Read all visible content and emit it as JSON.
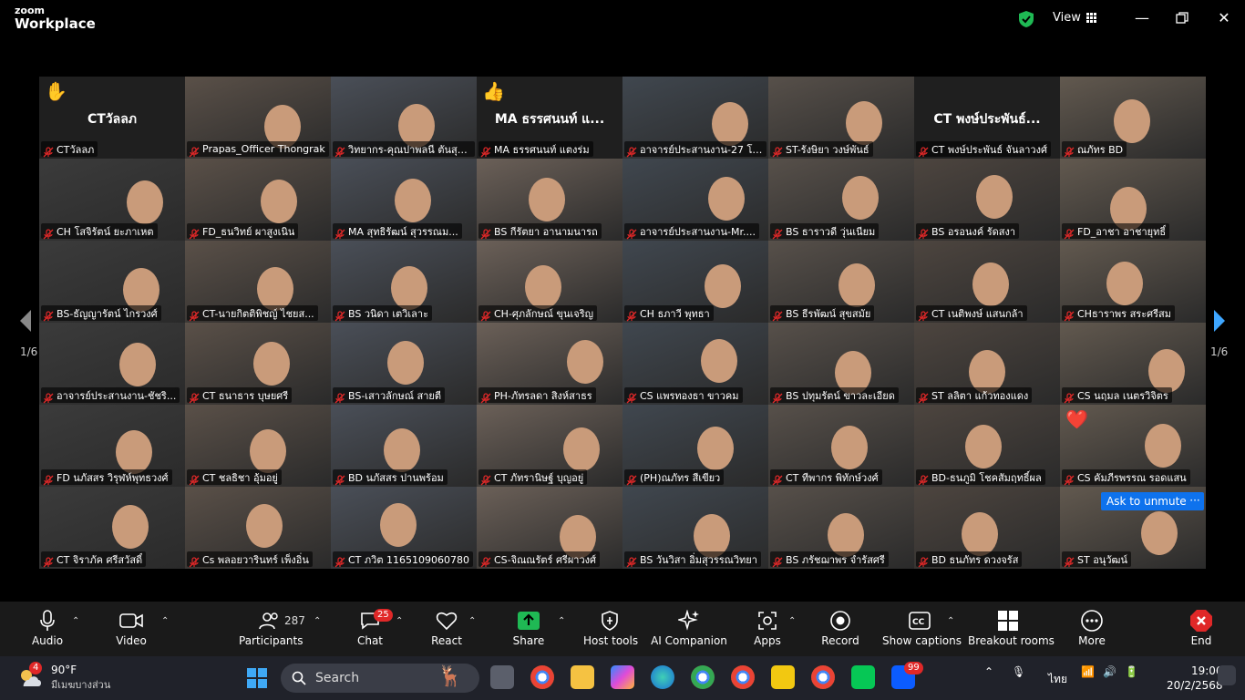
{
  "app": {
    "brand_top": "zoom",
    "brand_bottom": "Workplace"
  },
  "titlebar": {
    "view_label": "View"
  },
  "pagination": {
    "left": "1/6",
    "right": "1/6"
  },
  "unmute": {
    "label": "Ask to unmute",
    "more": "···"
  },
  "tiles": [
    {
      "name": "CTวัลลภ",
      "big": "CTวัลลภ",
      "reaction": "✋"
    },
    {
      "name": "Prapas_Officer Thongrak",
      "active": true
    },
    {
      "name": "วิทยากร-คุณปาพลนี ตันสุวร..."
    },
    {
      "name": "MA ธรรศนนท์ แตงร่ม",
      "big": "MA ธรรศนนท์ แ...",
      "reaction": "👍"
    },
    {
      "name": "อาจารย์ประสานงาน-27 โอม ..."
    },
    {
      "name": "ST-รังษิยา วงษ์พันธ์"
    },
    {
      "name": "CT พงษ์ประพันธ์ จันลาวงศ์",
      "big": "CT พงษ์ประพันธ์..."
    },
    {
      "name": "ณภัทร BD"
    },
    {
      "name": "CH โสจิรัตน์ ยะภาเหต"
    },
    {
      "name": "FD_ธนวิทย์ ผาสูงเนิน"
    },
    {
      "name": "MA สุทธิรัฒน์ สุวรรณม..."
    },
    {
      "name": "BS กีรัตยา อานามนารถ"
    },
    {
      "name": "อาจารย์ประสานงาน-Mr...."
    },
    {
      "name": "BS ธาราวดี วุ่นเนียม"
    },
    {
      "name": "BS อรอนงค์ รัดสงา"
    },
    {
      "name": "FD_อาชา อาชายุทธิ์"
    },
    {
      "name": "BS-ธัญญารัตน์ ไกรวงศ์"
    },
    {
      "name": "CT-นายกิตติพิชญ์ ไชยส..."
    },
    {
      "name": "BS วนิดา เตวิเลาะ"
    },
    {
      "name": "CH-ศุภลักษณ์ ขุนเจริญ"
    },
    {
      "name": "CH ธภาวี พุทธา"
    },
    {
      "name": "BS ธีรพัฒน์ สุขสมัย"
    },
    {
      "name": "CT เนติพงษ์ แสนกล้า"
    },
    {
      "name": "CHธาราพร สระศรีสม"
    },
    {
      "name": "อาจารย์ประสานงาน-ชัชริ..."
    },
    {
      "name": "CT ธนาธาร บุษยศรี"
    },
    {
      "name": "BS-เสาวลักษณ์ สายตี"
    },
    {
      "name": "PH-ภัทรลดา สิงห์สาธร"
    },
    {
      "name": "CS แพรทองธา ขาวคม"
    },
    {
      "name": "BS ปทุมรัตน์ ขาวละเอียด"
    },
    {
      "name": "ST ลลิตา แก้วทองแดง"
    },
    {
      "name": "CS นฤมล เนตรวิจิตร"
    },
    {
      "name": "FD นภัสสร วิรุฬห์พุทธวงศ์"
    },
    {
      "name": "CT ชลธิชา อุ้มอยู่"
    },
    {
      "name": "BD นภัสสร ปานพร้อม"
    },
    {
      "name": "CT ภัทรานิษฐ์ บุญอยู่"
    },
    {
      "name": "(PH)ณภัทร สีเขียว"
    },
    {
      "name": "CT ทีพากร พิทักษ์วงศ์"
    },
    {
      "name": "BD-ธนภูมิ โชคสัมฤทธิ์ผล"
    },
    {
      "name": "CS คัมภีรพรรณ รอดแสน",
      "reaction": "❤️"
    },
    {
      "name": "CT จิราภัค ศรีสวัสดิ์"
    },
    {
      "name": "Cs พลอยวารินทร์ เพ็งอิ่น"
    },
    {
      "name": "CT ภวิต 1165109060780"
    },
    {
      "name": "CS-จิณณรัตร์ ศรีผาวงศ์"
    },
    {
      "name": "BS วันวิสา อิ่มสุวรรณวิทยา"
    },
    {
      "name": "BS ภรัชฌาพร จำรัสศรี"
    },
    {
      "name": "BD ธนภัทร ดวงจรัส"
    },
    {
      "name": "ST อนุวัฒน์"
    }
  ],
  "toolbar": {
    "audio": "Audio",
    "video": "Video",
    "participants": "Participants",
    "participants_count": "287",
    "chat": "Chat",
    "chat_badge": "25",
    "react": "React",
    "share": "Share",
    "host_tools": "Host tools",
    "ai": "AI Companion",
    "apps": "Apps",
    "record": "Record",
    "captions": "Show captions",
    "breakout": "Breakout rooms",
    "more": "More",
    "end": "End"
  },
  "taskbar": {
    "weather_badge": "4",
    "temp": "90°F",
    "condition": "มีเมฆบางส่วน",
    "search": "Search",
    "zoom_badge": "99",
    "lang": "ไทย",
    "time": "19:06",
    "date": "20/2/2568"
  }
}
